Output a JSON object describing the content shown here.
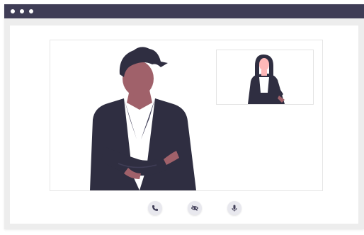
{
  "window": {
    "controls": [
      "window-dot",
      "window-dot",
      "window-dot"
    ]
  },
  "controls": {
    "call": {
      "icon": "phone-icon"
    },
    "camera": {
      "icon": "eye-off-icon"
    },
    "microphone": {
      "icon": "microphone-icon"
    }
  },
  "colors": {
    "titlebar": "#3f3d56",
    "suit": "#2f2e41",
    "skin": "#a0616a",
    "hair": "#2f2e41",
    "control_bg": "#e8e8ee",
    "icon": "#3f3d56"
  }
}
